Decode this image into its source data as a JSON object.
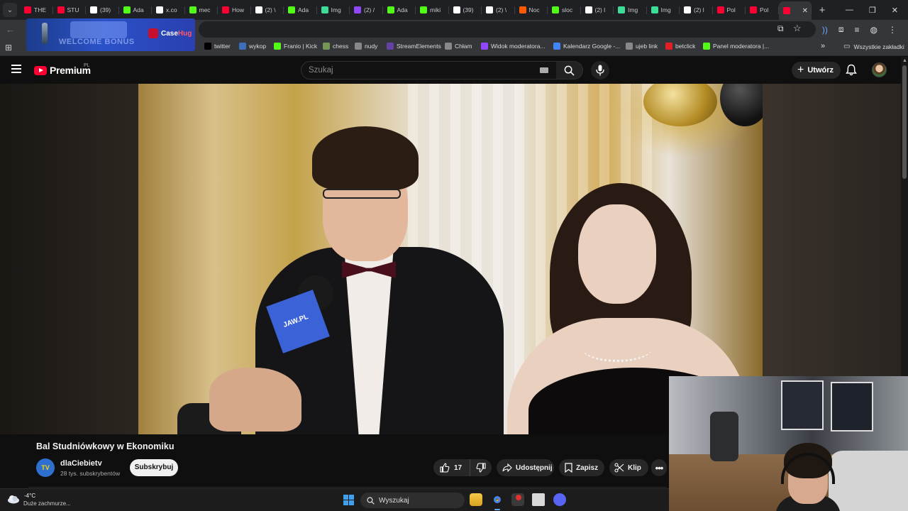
{
  "browser": {
    "tabs": [
      {
        "label": "THE",
        "icon": "youtube-icon",
        "color": "#ff0033"
      },
      {
        "label": "STU",
        "icon": "youtube-icon",
        "color": "#ff0033"
      },
      {
        "label": "(39)",
        "icon": "tiktok-icon",
        "color": "#ffffff"
      },
      {
        "label": "Ada",
        "icon": "kick-icon",
        "color": "#53fc18"
      },
      {
        "label": "x.co",
        "icon": "x-icon",
        "color": "#ffffff"
      },
      {
        "label": "mec",
        "icon": "kick-icon",
        "color": "#53fc18"
      },
      {
        "label": "How",
        "icon": "youtube-icon",
        "color": "#ff0033"
      },
      {
        "label": "(2) \\",
        "icon": "x-icon",
        "color": "#ffffff"
      },
      {
        "label": "Ada",
        "icon": "kick-icon",
        "color": "#53fc18"
      },
      {
        "label": "Img",
        "icon": "image-icon",
        "color": "#3ddc97"
      },
      {
        "label": "(2) /",
        "icon": "twitch-icon",
        "color": "#9146ff"
      },
      {
        "label": "Ada",
        "icon": "kick-icon",
        "color": "#53fc18"
      },
      {
        "label": "miki",
        "icon": "kick-icon",
        "color": "#53fc18"
      },
      {
        "label": "(39)",
        "icon": "tiktok-icon",
        "color": "#ffffff"
      },
      {
        "label": "(2) \\",
        "icon": "x-icon",
        "color": "#ffffff"
      },
      {
        "label": "Noc",
        "icon": "allegro-icon",
        "color": "#ff5a00"
      },
      {
        "label": "sloc",
        "icon": "kick-icon",
        "color": "#53fc18"
      },
      {
        "label": "(2) l",
        "icon": "x-icon",
        "color": "#ffffff"
      },
      {
        "label": "Img",
        "icon": "image-icon",
        "color": "#3ddc97"
      },
      {
        "label": "Img",
        "icon": "image-icon",
        "color": "#3ddc97"
      },
      {
        "label": "(2) l",
        "icon": "x-icon",
        "color": "#ffffff"
      },
      {
        "label": "Pol",
        "icon": "youtube-icon",
        "color": "#ff0033"
      },
      {
        "label": "Pol",
        "icon": "youtube-icon",
        "color": "#ff0033"
      },
      {
        "label": "",
        "icon": "youtube-icon",
        "color": "#ff0033",
        "active": true
      }
    ],
    "bookmarks": [
      {
        "label": "twitter",
        "icon": "x-icon",
        "color": "#000000"
      },
      {
        "label": "wykop",
        "icon": "wykop-icon",
        "color": "#3d6ebc"
      },
      {
        "label": "Franio | Kick",
        "icon": "kick-icon",
        "color": "#53fc18"
      },
      {
        "label": "chess",
        "icon": "chess-icon",
        "color": "#769656"
      },
      {
        "label": "nudy",
        "icon": "folder-icon",
        "color": "#888888"
      },
      {
        "label": "StreamElements",
        "icon": "streamelements-icon",
        "color": "#6441a5"
      },
      {
        "label": "Chłam",
        "icon": "link-icon",
        "color": "#888888"
      },
      {
        "label": "Widok moderatora...",
        "icon": "twitch-icon",
        "color": "#9146ff"
      },
      {
        "label": "Kalendarz Google -...",
        "icon": "calendar-icon",
        "color": "#4285f4"
      },
      {
        "label": "ujeb link",
        "icon": "link-icon",
        "color": "#888888"
      },
      {
        "label": "betclick",
        "icon": "betclick-icon",
        "color": "#e21f26"
      },
      {
        "label": "Panel moderatora |...",
        "icon": "kick-icon",
        "color": "#53fc18"
      }
    ],
    "all_bookmarks_label": "Wszystkie zakładki"
  },
  "ad": {
    "text": "WELCOME BONUS",
    "brand_main": "Case",
    "brand_accent": "Hug"
  },
  "youtube": {
    "logo_text": "Premium",
    "region": "PL",
    "search_placeholder": "Szukaj",
    "create_label": "Utwórz"
  },
  "video": {
    "title": "Bal Studniówkowy w Ekonomiku",
    "mic_label": "JAW.PL",
    "channel": {
      "name": "dlaCiebietv",
      "subscribers": "28 tys. subskrybentów",
      "avatar_text": "TV"
    },
    "subscribe_label": "Subskrybuj",
    "likes": "17",
    "share_label": "Udostępnij",
    "save_label": "Zapisz",
    "clip_label": "Klip"
  },
  "taskbar": {
    "weather_temp": "-4°C",
    "weather_desc": "Duże zachmurze...",
    "search_label": "Wyszukaj"
  }
}
